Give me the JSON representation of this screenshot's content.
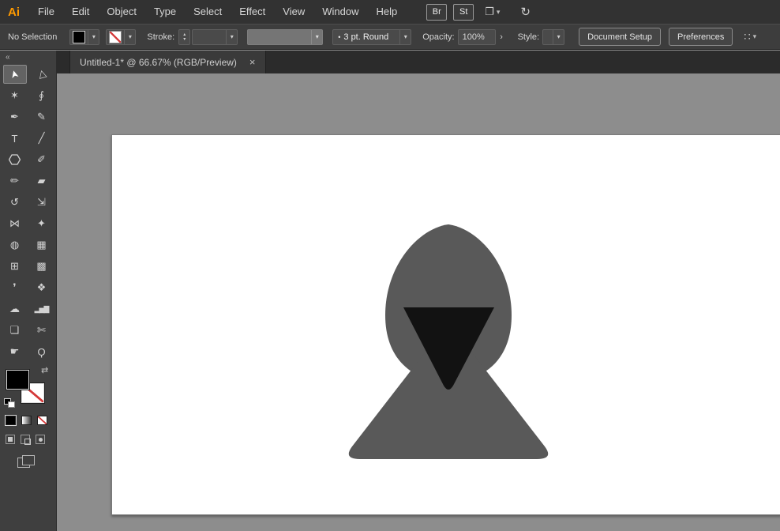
{
  "app": {
    "logo_text": "Ai",
    "logo_color": "#ff9a00"
  },
  "menubar": {
    "items": [
      "File",
      "Edit",
      "Object",
      "Type",
      "Select",
      "Effect",
      "View",
      "Window",
      "Help"
    ],
    "bridge_label": "Br",
    "stock_label": "St",
    "arrange_glyph": "❐",
    "sync_glyph": "↻"
  },
  "controlbar": {
    "selection_status": "No Selection",
    "stroke_label": "Stroke:",
    "profile_value": "3 pt. Round",
    "opacity_label": "Opacity:",
    "opacity_value": "100%",
    "style_label": "Style:",
    "document_setup_label": "Document Setup",
    "preferences_label": "Preferences",
    "panel_options_glyph": "∷"
  },
  "tabbar": {
    "tab_title": "Untitled-1* @ 66.67% (RGB/Preview)",
    "close_glyph": "×"
  },
  "ui": {
    "chevron_down": "▾",
    "chevron_right": "›",
    "spin_up": "▴",
    "spin_down": "▾",
    "bullet": "•"
  },
  "toolbar": {
    "collapse_glyph": "«",
    "swap_glyph": "⇄",
    "tools": [
      {
        "name": "selection",
        "glyph": "➤"
      },
      {
        "name": "direct-selection",
        "glyph": "▷"
      },
      {
        "name": "magic-wand",
        "glyph": "✶"
      },
      {
        "name": "lasso",
        "glyph": "∮"
      },
      {
        "name": "pen",
        "glyph": "✒"
      },
      {
        "name": "curvature",
        "glyph": "✎"
      },
      {
        "name": "type",
        "glyph": "T"
      },
      {
        "name": "line-segment",
        "glyph": "╱"
      },
      {
        "name": "polygon",
        "glyph": ""
      },
      {
        "name": "paintbrush",
        "glyph": "✐"
      },
      {
        "name": "shaper",
        "glyph": "✏"
      },
      {
        "name": "eraser",
        "glyph": "▰"
      },
      {
        "name": "rotate",
        "glyph": "↺"
      },
      {
        "name": "scale",
        "glyph": "⇲"
      },
      {
        "name": "width",
        "glyph": "⋈"
      },
      {
        "name": "free-transform",
        "glyph": "✦"
      },
      {
        "name": "shape-builder",
        "glyph": "◍"
      },
      {
        "name": "perspective-grid",
        "glyph": "▦"
      },
      {
        "name": "mesh",
        "glyph": "⊞"
      },
      {
        "name": "gradient",
        "glyph": "▩"
      },
      {
        "name": "eyedropper",
        "glyph": "❜"
      },
      {
        "name": "blend",
        "glyph": "❖"
      },
      {
        "name": "symbol-sprayer",
        "glyph": "☁"
      },
      {
        "name": "column-graph",
        "glyph": "▂▅▇"
      },
      {
        "name": "artboard",
        "glyph": "❏"
      },
      {
        "name": "slice",
        "glyph": "✄"
      },
      {
        "name": "hand",
        "glyph": "☛"
      },
      {
        "name": "zoom",
        "glyph": "Ϙ"
      }
    ]
  },
  "canvas": {
    "background_color": "#8d8d8d",
    "artboard_color": "#ffffff",
    "figure_color": "#595959",
    "face_color": "#121212"
  }
}
